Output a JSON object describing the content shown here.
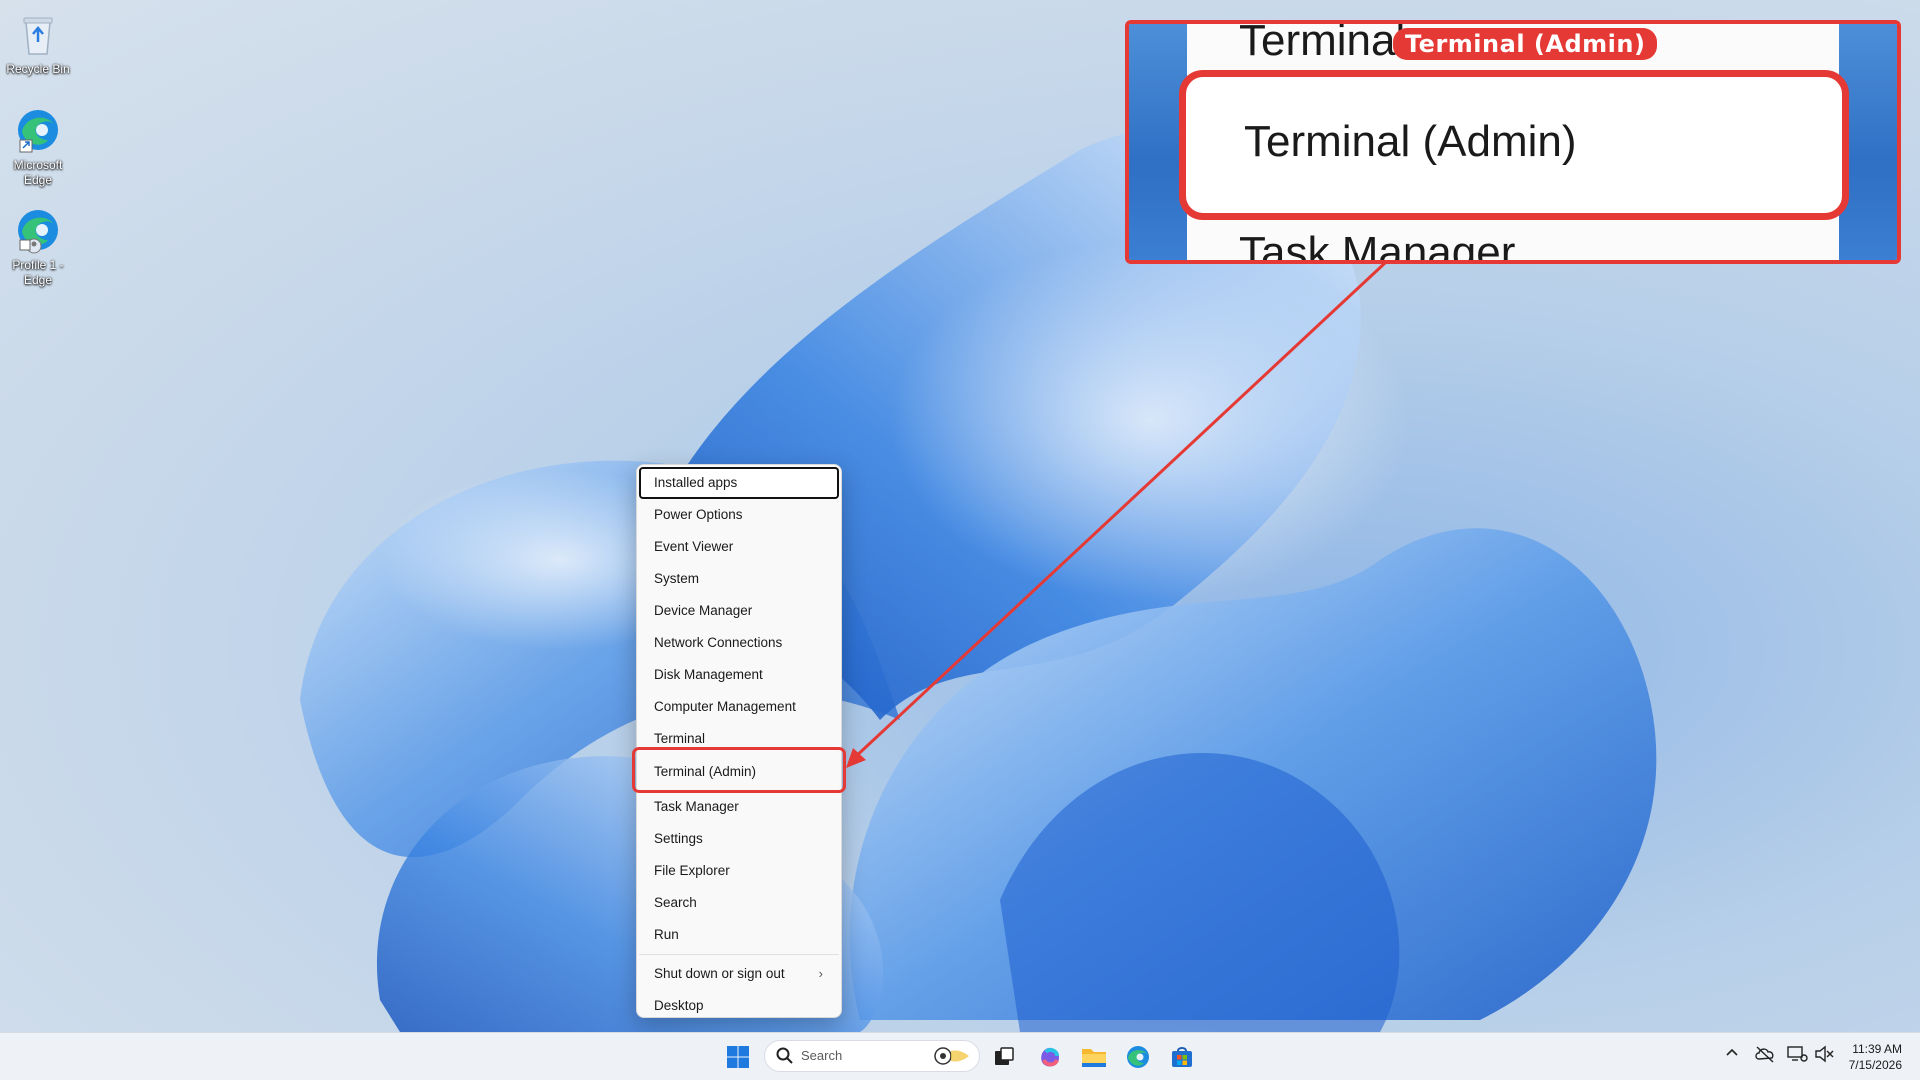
{
  "desktop_icons": [
    {
      "label": "Recycle Bin",
      "icon": "recycle-bin-icon"
    },
    {
      "label": "Microsoft Edge",
      "icon": "edge-icon"
    },
    {
      "label": "Profile 1 - Edge",
      "icon": "edge-profile-icon"
    }
  ],
  "menu": {
    "items": [
      {
        "label": "Installed apps"
      },
      {
        "label": "Power Options"
      },
      {
        "label": "Event Viewer"
      },
      {
        "label": "System"
      },
      {
        "label": "Device Manager"
      },
      {
        "label": "Network Connections"
      },
      {
        "label": "Disk Management"
      },
      {
        "label": "Computer Management"
      },
      {
        "label": "Terminal"
      },
      {
        "label": "Terminal (Admin)"
      },
      {
        "label": "Task Manager"
      },
      {
        "label": "Settings"
      },
      {
        "label": "File Explorer"
      },
      {
        "label": "Search"
      },
      {
        "label": "Run"
      },
      {
        "label": "Shut down or sign out"
      },
      {
        "label": "Desktop"
      }
    ],
    "chevron": "›"
  },
  "callout": {
    "tag": "Terminal (Admin)",
    "top_text": "Terminal",
    "main_text": "Terminal (Admin)",
    "bottom_text": "Task Manager"
  },
  "taskbar": {
    "search_placeholder": "Search",
    "time": "11:39 AM",
    "date": "7/15/2026",
    "accent": "#e53935"
  }
}
